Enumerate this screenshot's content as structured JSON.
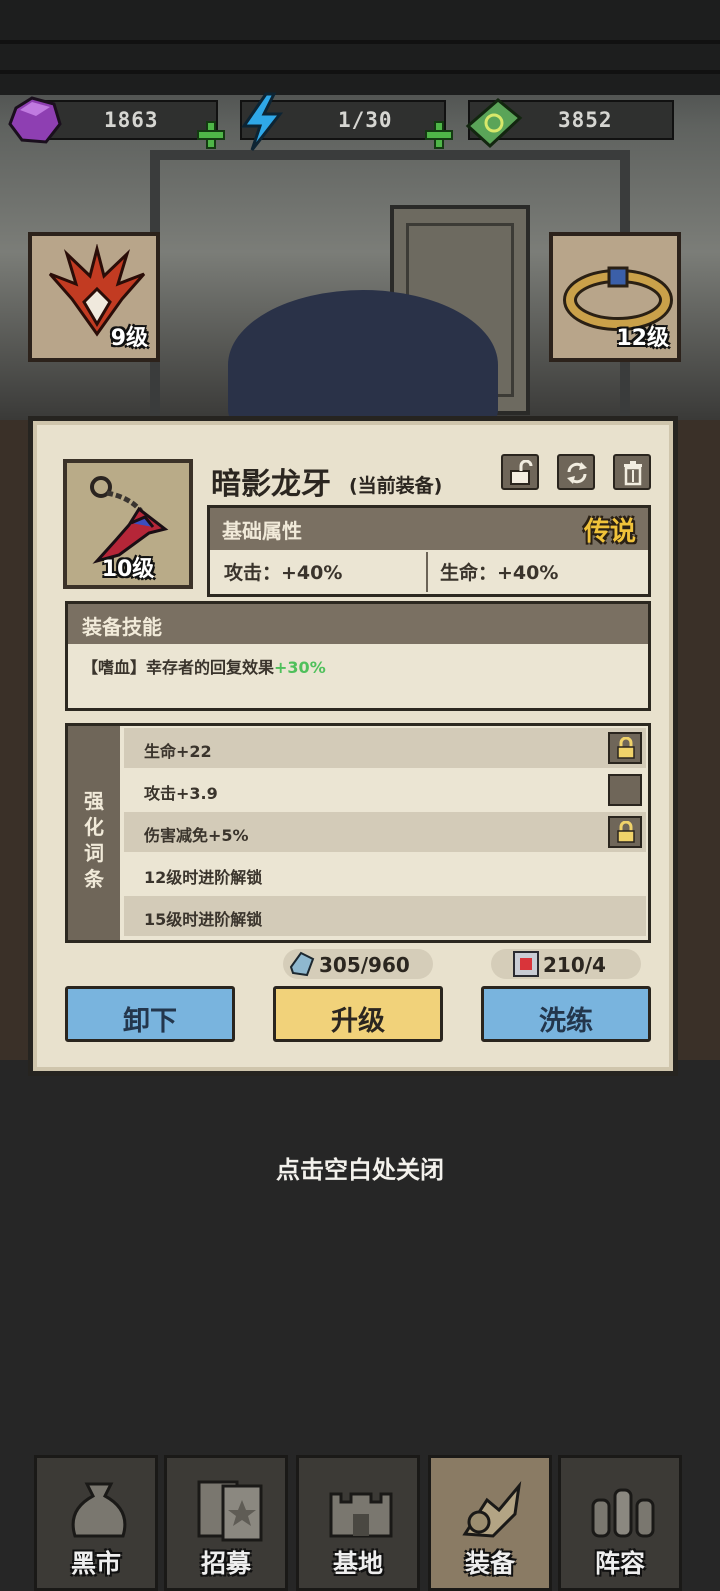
{
  "resources": {
    "gem": {
      "icon": "purple-gem-icon",
      "value": "1863"
    },
    "energy": {
      "icon": "lightning-icon",
      "value": "1/30"
    },
    "cash": {
      "icon": "green-banknote-icon",
      "value": "3852"
    }
  },
  "side_slots": {
    "left": {
      "icon": "phoenix-mask-icon",
      "level": "9级"
    },
    "right": {
      "icon": "bracelet-icon",
      "level": "12级"
    }
  },
  "equipment": {
    "icon": "chain-dagger-icon",
    "level": "10级",
    "name": "暗影龙牙",
    "name_suffix": "(当前装备)",
    "rarity": "传说",
    "rarity_color": "#f0c23a",
    "base_stats_title": "基础属性",
    "stats": [
      {
        "label": "攻击：+40%"
      },
      {
        "label": "生命：+40%"
      }
    ],
    "skill_title": "装备技能",
    "skill_text": "【嗜血】幸存者的回复效果",
    "skill_bonus": "+30%",
    "skill_bonus_color": "#4fc05b",
    "affix_title": "强化词条",
    "affixes": [
      {
        "label": "生命+22",
        "control": "lock-icon"
      },
      {
        "label": "攻击+3.9",
        "control": "empty-checkbox"
      },
      {
        "label": "伤害减免+5%",
        "control": "lock-icon"
      },
      {
        "label": "12级时进阶解锁",
        "control": ""
      },
      {
        "label": "15级时进阶解锁",
        "control": ""
      }
    ],
    "costs": [
      {
        "icon": "crystal-material-icon",
        "value": "305/960"
      },
      {
        "icon": "cube-material-icon",
        "value": "210/4"
      }
    ],
    "top_buttons": [
      "unlock-icon",
      "swap-icon",
      "trash-icon"
    ]
  },
  "actions": {
    "unequip": "卸下",
    "upgrade": "升级",
    "reforge": "洗练"
  },
  "close_hint": "点击空白处关闭",
  "nav": [
    {
      "label": "黑市",
      "icon": "money-bag-icon"
    },
    {
      "label": "招募",
      "icon": "cards-icon"
    },
    {
      "label": "基地",
      "icon": "castle-icon"
    },
    {
      "label": "装备",
      "icon": "equipment-icon",
      "active": true
    },
    {
      "label": "阵容",
      "icon": "team-icon"
    }
  ]
}
